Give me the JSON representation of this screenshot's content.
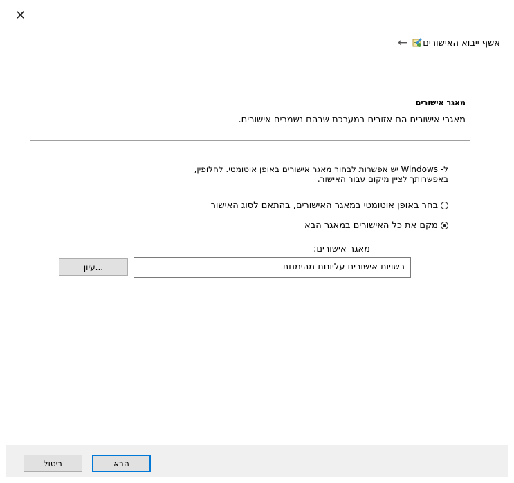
{
  "window": {
    "close_glyph": "✕"
  },
  "header": {
    "back_glyph": "←",
    "title": "אשף ייבוא האישורים"
  },
  "section": {
    "heading": "מאגר אישורים",
    "description": "מאגרי אישורים הם אזורים במערכת שבהם נשמרים אישורים."
  },
  "info": {
    "line1": "ל- Windows יש אפשרות לבחור מאגר אישורים באופן אוטומטי. לחלופין,",
    "line2": "באפשרותך לציין מיקום עבור האישור."
  },
  "options": {
    "auto_label": "בחר באופן אוטומטי במאגר האישורים, בהתאם לסוג האישור",
    "manual_label": "מקם את כל האישורים במאגר הבא",
    "selected": "manual"
  },
  "store": {
    "label": "מאגר אישורים:",
    "value": "רשויות אישורים עליונות מהימנות",
    "browse_label": "עיון..."
  },
  "footer": {
    "next_label": "הבא",
    "cancel_label": "ביטול"
  },
  "colors": {
    "accent": "#0078d7",
    "frame": "#7fa9d8",
    "footer_bg": "#f0f0f0"
  }
}
